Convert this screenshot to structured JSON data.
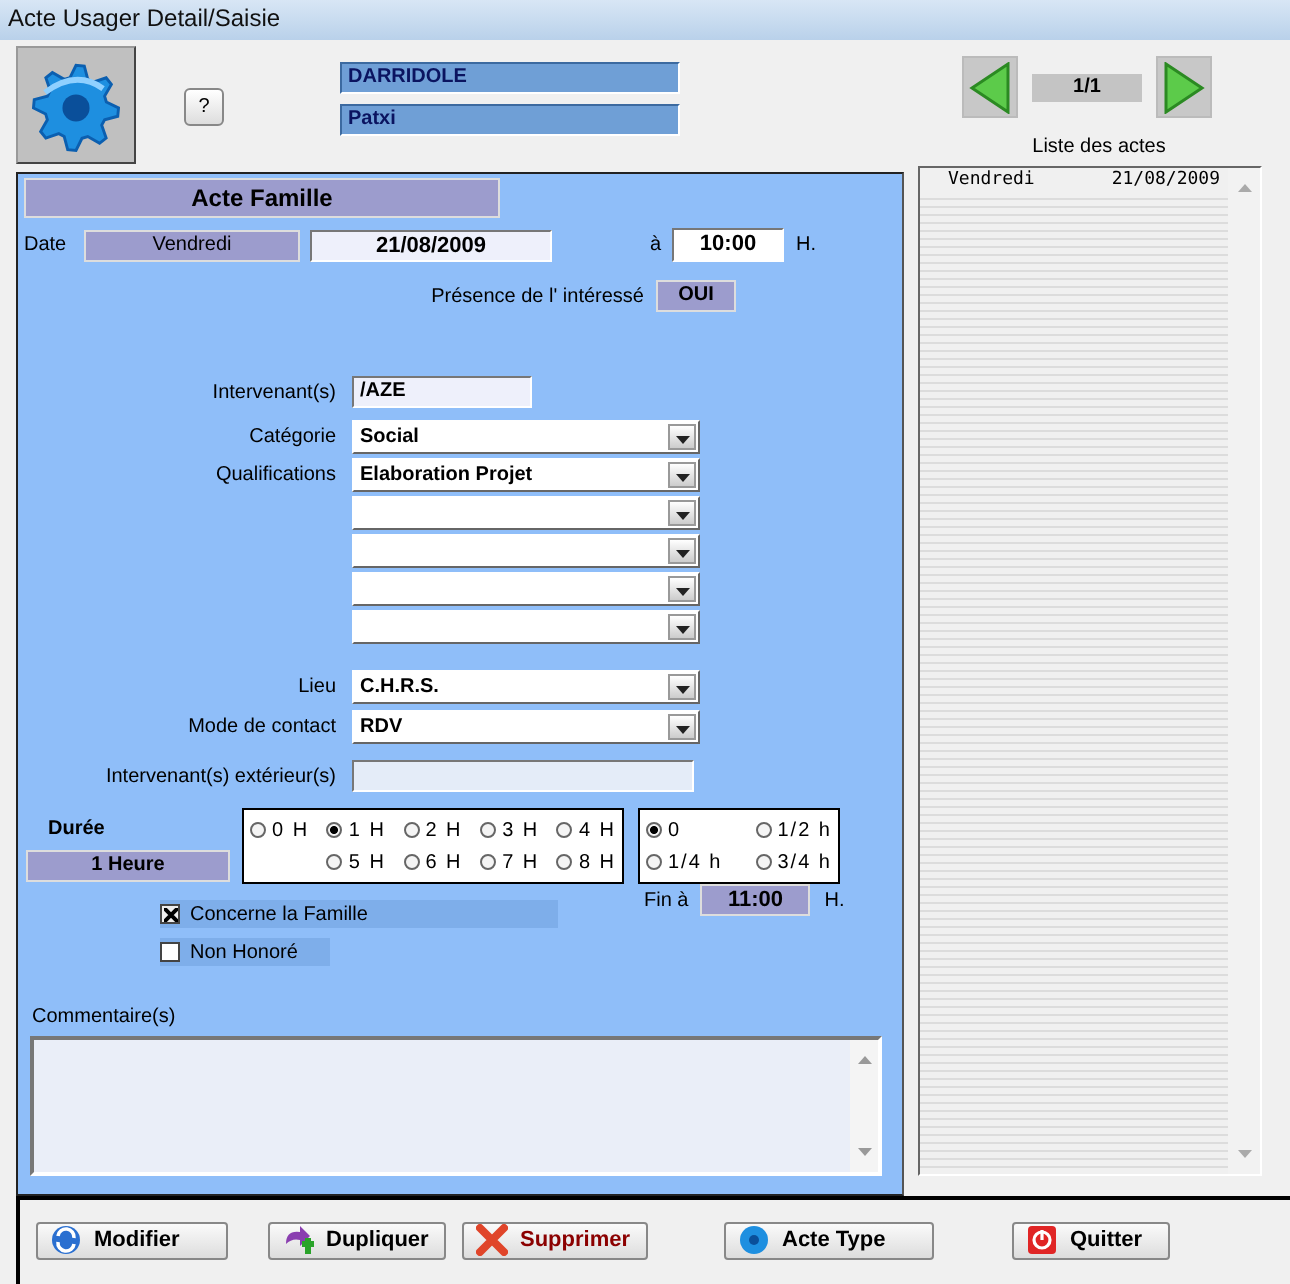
{
  "window": {
    "title": "Acte Usager Detail/Saisie"
  },
  "header": {
    "help_button": "?",
    "last_name": "DARRIDOLE",
    "first_name": "Patxi",
    "counter": "1/1"
  },
  "form": {
    "title": "Acte Famille",
    "date_label": "Date",
    "day": "Vendredi",
    "date": "21/08/2009",
    "at_label": "à",
    "time": "10:00",
    "time_unit": "H.",
    "presence": {
      "label": "Présence de l' intéressé",
      "value": "OUI"
    },
    "intervenants": {
      "label": "Intervenant(s)",
      "value": "/AZE"
    },
    "category": {
      "label": "Catégorie",
      "value": "Social"
    },
    "qualifications": {
      "label": "Qualifications",
      "slots": [
        {
          "kind": "filled",
          "value": "Elaboration Projet"
        },
        {
          "kind": "empty"
        },
        {
          "kind": "empty"
        },
        {
          "kind": "empty"
        },
        {
          "kind": "empty"
        }
      ]
    },
    "place": {
      "label": "Lieu",
      "value": "C.H.R.S."
    },
    "contact_mode": {
      "label": "Mode de contact",
      "value": "RDV"
    },
    "external": {
      "label": "Intervenant(s) extérieur(s)"
    },
    "duration": {
      "label": "Durée",
      "value": "1 Heure",
      "hours": [
        {
          "label": "0 H",
          "selected": false
        },
        {
          "label": "1 H",
          "selected": true
        },
        {
          "label": "2 H",
          "selected": false
        },
        {
          "label": "3 H",
          "selected": false
        },
        {
          "label": "4 H",
          "selected": false
        },
        {
          "label": "5 H",
          "selected": false
        },
        {
          "label": "6 H",
          "selected": false
        },
        {
          "label": "7 H",
          "selected": false
        },
        {
          "label": "8 H",
          "selected": false
        }
      ],
      "fractions": [
        {
          "label": "0",
          "selected": true
        },
        {
          "label": "1/2 h",
          "selected": false
        },
        {
          "label": "1/4 h",
          "selected": false
        },
        {
          "label": "3/4 h",
          "selected": false
        }
      ]
    },
    "checkboxes": [
      {
        "label": "Concerne la Famille",
        "checked": true
      },
      {
        "label": "Non Honoré",
        "checked": false
      }
    ],
    "end": {
      "label": "Fin à",
      "value": "11:00",
      "unit": "H."
    },
    "comment": {
      "label": "Commentaire(s)"
    }
  },
  "list": {
    "title": "Liste des actes",
    "rows": [
      {
        "day": "Vendredi",
        "date": "21/08/2009"
      }
    ]
  },
  "buttons": [
    {
      "label": "Modifier",
      "kind": "modify"
    },
    {
      "label": "Dupliquer",
      "kind": "duplicate"
    },
    {
      "label": "Supprimer",
      "kind": "delete"
    },
    {
      "label": "Acte Type",
      "kind": "template"
    },
    {
      "label": "Quitter",
      "kind": "quit"
    }
  ]
}
